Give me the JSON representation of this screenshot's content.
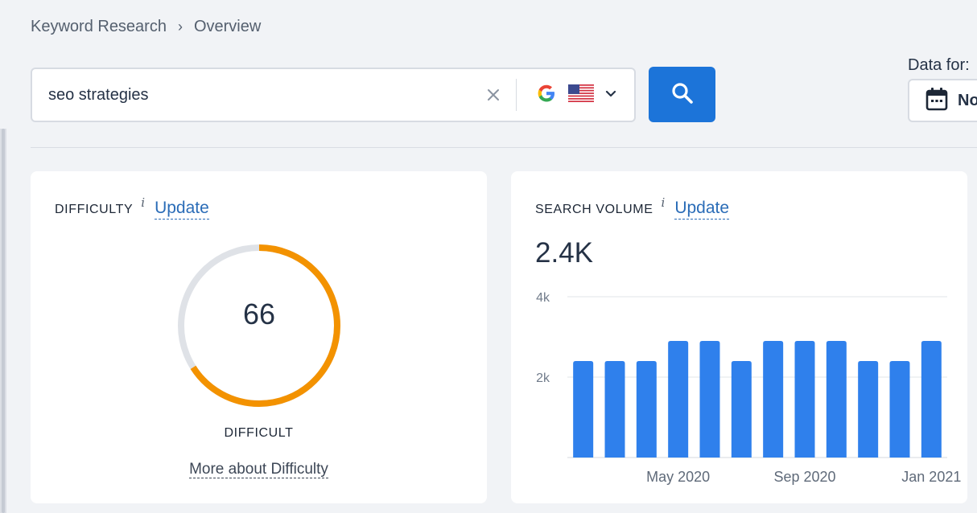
{
  "breadcrumb": {
    "items": [
      "Keyword Research",
      "Overview"
    ],
    "separator": "›"
  },
  "search": {
    "query": "seo strategies",
    "engine": "Google",
    "country": "US"
  },
  "date_filter": {
    "label": "Data for:",
    "value": "No"
  },
  "difficulty": {
    "title": "DIFFICULTY",
    "info": "i",
    "update_label": "Update",
    "value": "66",
    "score": 66,
    "max": 100,
    "level": "DIFFICULT",
    "more_link": "More about Difficulty",
    "colors": {
      "track": "#dfe2e7",
      "fill": "#f39200"
    }
  },
  "volume": {
    "title": "SEARCH VOLUME",
    "info": "i",
    "update_label": "Update",
    "value": "2.4K"
  },
  "chart_data": {
    "type": "bar",
    "categories": [
      "",
      "",
      "",
      "May 2020",
      "",
      "",
      "",
      "Sep 2020",
      "",
      "",
      "",
      "Jan 2021"
    ],
    "values": [
      2400,
      2400,
      2400,
      2900,
      2900,
      2400,
      2900,
      2900,
      2900,
      2400,
      2400,
      2900
    ],
    "x_tick_labels": [
      "May 2020",
      "Sep 2020",
      "Jan 2021"
    ],
    "y_ticks": [
      "4k",
      "2k"
    ],
    "y_tick_values": [
      4000,
      2000
    ],
    "ylim": [
      0,
      4000
    ],
    "grid": true,
    "bar_color": "#2f80ec"
  },
  "colors": {
    "accent": "#1c74d9",
    "link": "#2a6cb7",
    "text": "#253246",
    "background": "#f1f3f6"
  },
  "icons": {
    "clear": "close-icon",
    "engine": "google-icon",
    "country": "us-flag-icon",
    "dropdown": "chevron-down-icon",
    "search": "search-icon",
    "calendar": "calendar-icon"
  }
}
